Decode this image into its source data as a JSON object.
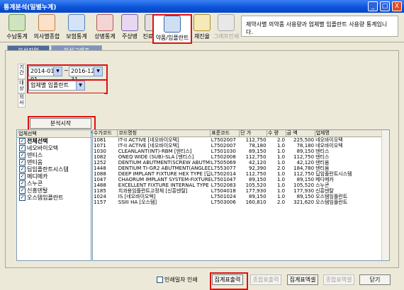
{
  "window": {
    "title": "통계분석(일별누계)",
    "min": "_",
    "max": "□",
    "close": "X"
  },
  "toolbar": {
    "items": [
      {
        "label": "수납통계",
        "icon": "cash-register-icon"
      },
      {
        "label": "의사별종합",
        "icon": "doctor-icon"
      },
      {
        "label": "보험통계",
        "icon": "insurance-icon"
      },
      {
        "label": "상병통계",
        "icon": "disease-icon"
      },
      {
        "label": "주상병",
        "icon": "main-disease-icon"
      },
      {
        "label": "진료통계",
        "icon": "treatment-icon"
      },
      {
        "label": "약품/임플란트",
        "icon": "medicine-implant-icon"
      },
      {
        "label": "재진율",
        "icon": "revisit-rate-icon"
      },
      {
        "label": "그래프인쇄",
        "icon": "printer-icon"
      }
    ],
    "description": "제약사별 의약품 사용량과 업체별 임플란트 사용량 통계입니다."
  },
  "tabs": [
    "분석작업",
    "분석그래프"
  ],
  "form": {
    "period_label": "기간",
    "date_from": "2014-01-01",
    "date_sep": "~",
    "date_to": "2016-12-31",
    "type_label": "대상",
    "type_value": "업체별 임플란트",
    "doctor_label": "의사"
  },
  "start_button": "분석시작",
  "company_list": {
    "header": "업체선택",
    "items": [
      "전체선택",
      "네오바이오텍",
      "덴티스",
      "덴티움",
      "딥임플란트시스템",
      "메디메카",
      "스누콘",
      "신흥덴탈",
      "오스템임플란트"
    ]
  },
  "grid": {
    "columns": [
      "수가코드",
      "코드명칭",
      "표준코드",
      "단  가",
      "수  량",
      "금  액",
      "업체명"
    ],
    "rows": [
      [
        "1081",
        "IT-II ACTIVE [네오바이오텍]",
        "L7502007",
        "112,750",
        "2.0",
        "225,500",
        "네오바이오텍"
      ],
      [
        "1071",
        "IT-II ACTIVE [네오바이오텍]",
        "L7502007",
        "78,180",
        "1.0",
        "78,180",
        "네오바이오텍"
      ],
      [
        "1030",
        "CLEANLANT(INT)-RBM [덴티스]",
        "L7501030",
        "89,150",
        "1.0",
        "89,150",
        "덴티스"
      ],
      [
        "1082",
        "ONEQ WIDE (SUB)-SLA [덴티스]",
        "L7502008",
        "112,750",
        "1.0",
        "112,750",
        "덴티스"
      ],
      [
        "1252",
        "DENTIUM ABUTMENT(SCREW ABUTMENT) [덴...",
        "L7505069",
        "42,120",
        "1.0",
        "42,120",
        "덴티움"
      ],
      [
        "1448",
        "DENTIUM TI-GR2 ABUTMENT(ANGLED ABUT...",
        "L7553077",
        "92,390",
        "2.0",
        "184,780",
        "덴티움"
      ],
      [
        "1088",
        "DEEP IMPLANT FIXTURE HEX TYPE [딥임...",
        "L7502014",
        "112,750",
        "1.0",
        "112,750",
        "딥임플란트시스템"
      ],
      [
        "1047",
        "CHAORUM IMPLANT SYSTEM-FIXTURE( ) ...",
        "L7501047",
        "89,150",
        "1.0",
        "89,150",
        "메디메카"
      ],
      [
        "1488",
        "EXCELLENT FIXTURE INTERNAL TYPE EF ...",
        "L7502083",
        "105,520",
        "1.0",
        "105,520",
        "스누콘"
      ],
      [
        "1185",
        "치과용임플란트고정체 [신흥덴탈]",
        "L7504018",
        "177,930",
        "1.0",
        "177,930",
        "신흥덴탈"
      ],
      [
        "1024",
        "IS [네오바이오텍]",
        "L7501024",
        "89,150",
        "1.0",
        "89,150",
        "오스템임플란트"
      ],
      [
        "1157",
        "SSIII HA [오스템]",
        "L7503006",
        "160,810",
        "2.0",
        "321,620",
        "오스템임플란트"
      ]
    ]
  },
  "bottom": {
    "checkbox_label": "인쇄일자 인쇄",
    "buttons": [
      "집계표출력",
      "종합표출력",
      "집계표엑셀",
      "종합표엑셀",
      "닫기"
    ]
  }
}
